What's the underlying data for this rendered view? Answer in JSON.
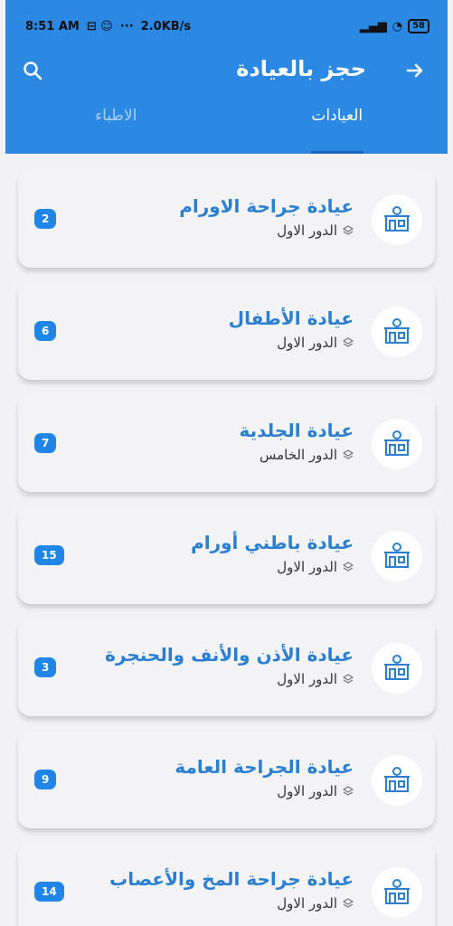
{
  "status_bar": {
    "time": "8:51 AM",
    "net_speed": "2.0KB/s",
    "more": "···",
    "battery": "58"
  },
  "appbar": {
    "title": "حجز بالعيادة"
  },
  "tabs": [
    {
      "label": "العيادات",
      "active": true
    },
    {
      "label": "الاطباء",
      "active": false
    }
  ],
  "clinics": [
    {
      "name": "عيادة جراحة الاورام",
      "floor": "الدور الاول",
      "count": "2"
    },
    {
      "name": "عيادة الأطفال",
      "floor": "الدور الاول",
      "count": "6"
    },
    {
      "name": "عيادة الجلدية",
      "floor": "الدور الخامس",
      "count": "7"
    },
    {
      "name": "عيادة باطني أورام",
      "floor": "الدور الاول",
      "count": "15"
    },
    {
      "name": "عيادة الأذن والأنف والحنجرة",
      "floor": "الدور الاول",
      "count": "3"
    },
    {
      "name": "عيادة الجراحة العامة",
      "floor": "الدور الاول",
      "count": "9"
    },
    {
      "name": "عيادة جراحة المخ والأعصاب",
      "floor": "الدور الاول",
      "count": "14"
    }
  ],
  "colors": {
    "primary": "#2b88e3",
    "clinic_title": "#2b7fd0",
    "badge": "#1f85e6",
    "background": "#f2f2f4"
  },
  "icons": {
    "back": "arrow-right-icon",
    "search": "search-icon",
    "clinic": "clinic-building-icon",
    "floor": "layers-icon"
  }
}
